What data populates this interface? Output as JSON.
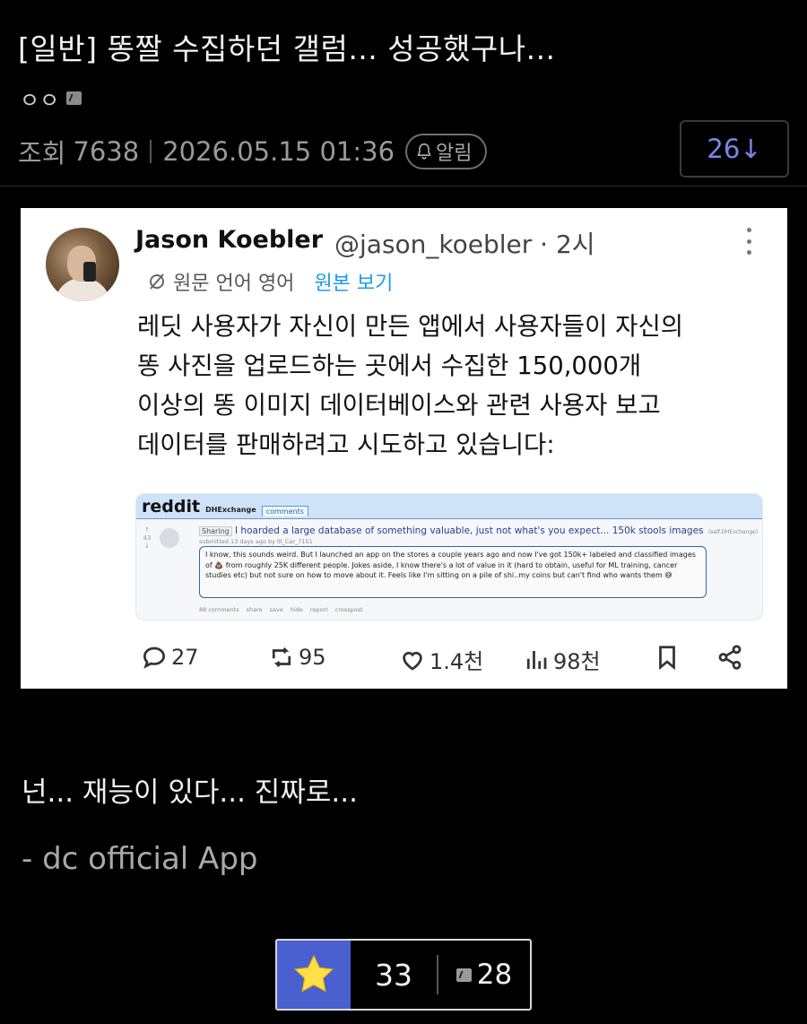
{
  "post": {
    "title": "[일반] 똥짤 수집하던 갤럼... 성공했구나...",
    "author": "ㅇㅇ",
    "views_label": "조회",
    "views": "7638",
    "datetime": "2026.05.15 01:36",
    "alarm_label": "알림",
    "comment_count": "26↓"
  },
  "tweet": {
    "name": "Jason Koebler",
    "handle_time": "@jason_koebler · 2시",
    "translated_label": "원문 언어 영어",
    "view_original": "원본 보기",
    "text_lines": [
      "레딧 사용자가 자신이 만든 앱에서 사용자들이 자신의",
      "똥 사진을 업로드하는 곳에서 수집한 150,000개",
      "이상의 똥 이미지 데이터베이스와 관련 사용자 보고",
      "데이터를 판매하려고 시도하고 있습니다:"
    ],
    "embed": {
      "logo": "reddit",
      "subreddit": "DHExchange",
      "tab": "comments",
      "votes": [
        "↑",
        "43",
        "↓"
      ],
      "flair": "Sharing",
      "title": "I hoarded a large database of something valuable, just not what's you expect... 150k stools images",
      "title_tag": "(self.DHExchange)",
      "submitted": "submitted 13 days ago by Ill_Car_7151",
      "body": "I know, this sounds weird. But I launched an app on the stores a couple years ago and now I've got 150k+ labeled and classified images of 💩 from roughly 25K different people. Jokes aside, I know there's a lot of value in it (hard to obtain, useful for ML training, cancer studies etc) but not sure on how to move about it. Feels like I'm sitting on a pile of shi..my coins but can't find who wants them 😅",
      "actions": [
        "88 comments",
        "share",
        "save",
        "hide",
        "report",
        "crosspost"
      ]
    },
    "stats": {
      "replies": "27",
      "retweets": "95",
      "likes": "1.4천",
      "views": "98천"
    }
  },
  "body": {
    "line1": "넌... 재능이 있다... 진짜로...",
    "line2": "- dc official App"
  },
  "votes": {
    "recommend": "33",
    "dislike": "28"
  },
  "colors": {
    "background": "#000000",
    "accent_blue": "#7b86e6",
    "recommend_bg": "#4a5fd0",
    "star": "#ffe04b"
  }
}
